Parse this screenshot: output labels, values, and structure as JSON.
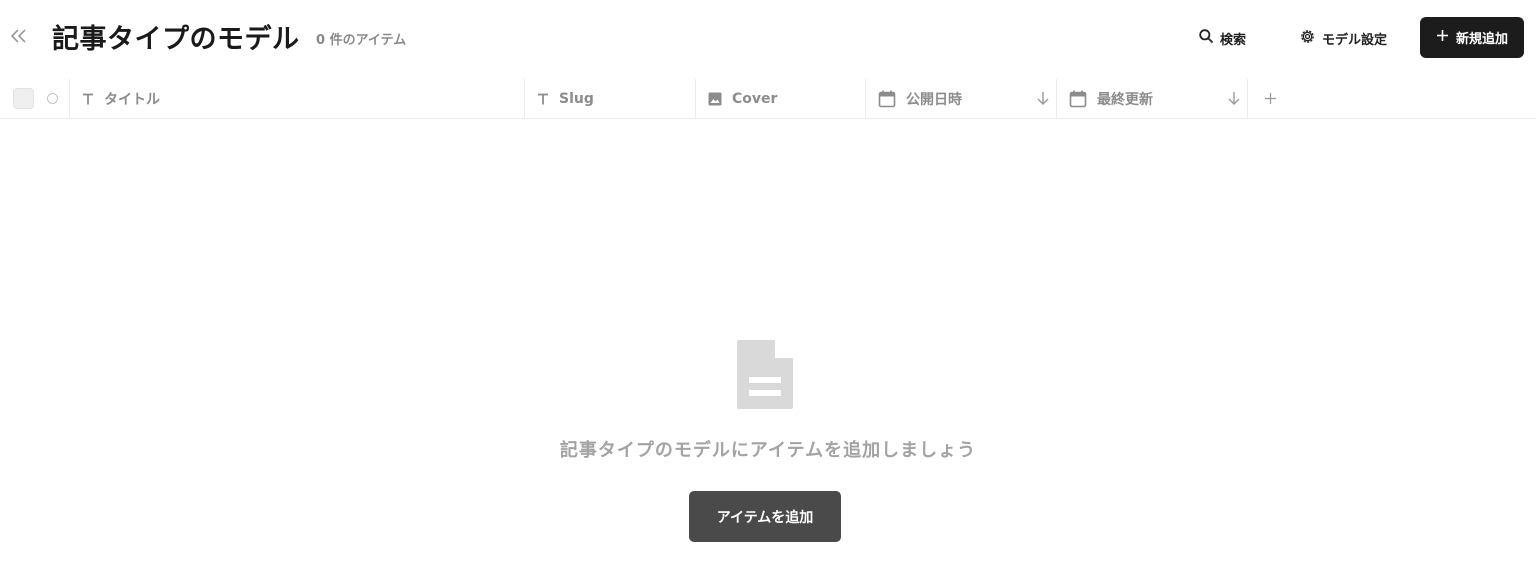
{
  "header": {
    "title": "記事タイプのモデル",
    "item_count": "0 件のアイテム",
    "search_label": "検索",
    "settings_label": "モデル設定",
    "new_label": "新規追加"
  },
  "columns": [
    {
      "label": "タイトル",
      "icon": "text-type-icon"
    },
    {
      "label": "Slug",
      "icon": "text-type-icon"
    },
    {
      "label": "Cover",
      "icon": "image-icon"
    },
    {
      "label": "公開日時",
      "icon": "calendar-icon",
      "sort": "descending"
    },
    {
      "label": "最終更新",
      "icon": "calendar-icon",
      "sort": "descending"
    }
  ],
  "empty_state": {
    "icon": "document-icon",
    "message": "記事タイプのモデルにアイテムを追加しましょう",
    "button_label": "アイテムを追加"
  },
  "colors": {
    "primary_button": "#1c1c1c",
    "empty_button": "#4a4a4a",
    "muted_text": "#a3a3a3"
  }
}
